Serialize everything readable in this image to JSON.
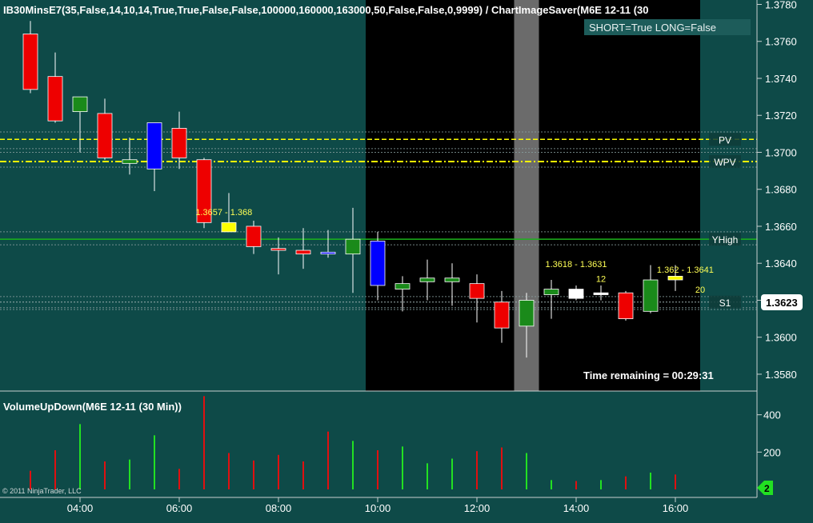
{
  "colors": {
    "background": "#0e4a48",
    "axis_background": "#0f4c4a",
    "session_shade": "#000000",
    "current_bar_shade": "#6b6b6b",
    "up_candle": "#1a8a1a",
    "down_candle": "#ee0000",
    "blue_candle": "#0000ff",
    "yellow_candle": "#ffff00",
    "white_candle": "#ffffff",
    "pv_line": "#ffff00",
    "yhigh_line": "#1bb31b",
    "volume_up": "#22e022",
    "volume_down": "#e01010",
    "text": "#ffffff",
    "label_yellow": "#ffff55"
  },
  "chart_data": [
    {
      "type": "candlestick",
      "title": "IB30MinsE7(35,False,14,10,14,True,True,False,False,100000,160000,163000,50,False,False,0,9999)  /  ChartImageSaver(M6E  12-11  (30",
      "status_box": "SHORT=True LONG=False",
      "ylim": [
        1.3575,
        1.378
      ],
      "ytick_labels": [
        "1.3780",
        "1.3760",
        "1.3740",
        "1.3720",
        "1.3700",
        "1.3680",
        "1.3660",
        "1.3640",
        "1.3620",
        "1.3600",
        "1.3580"
      ],
      "ytick_values": [
        1.378,
        1.376,
        1.374,
        1.372,
        1.37,
        1.368,
        1.366,
        1.364,
        1.362,
        1.36,
        1.358
      ],
      "xtick_labels": [
        "04:00",
        "06:00",
        "08:00",
        "10:00",
        "12:00",
        "14:00",
        "16:00"
      ],
      "xtick_hours": [
        4,
        6,
        8,
        10,
        12,
        14,
        16
      ],
      "last_price": "1.3623",
      "candles": [
        {
          "t": 3.0,
          "o": 1.3764,
          "h": 1.3771,
          "l": 1.3732,
          "c": 1.3734,
          "color": "down"
        },
        {
          "t": 3.5,
          "o": 1.3741,
          "h": 1.3754,
          "l": 1.3716,
          "c": 1.3717,
          "color": "down"
        },
        {
          "t": 4.0,
          "o": 1.3722,
          "h": 1.373,
          "l": 1.37,
          "c": 1.373,
          "color": "up"
        },
        {
          "t": 4.5,
          "o": 1.3721,
          "h": 1.3729,
          "l": 1.3696,
          "c": 1.3697,
          "color": "down"
        },
        {
          "t": 5.0,
          "o": 1.3694,
          "h": 1.3708,
          "l": 1.3688,
          "c": 1.3696,
          "color": "up"
        },
        {
          "t": 5.5,
          "o": 1.3716,
          "h": 1.3716,
          "l": 1.3679,
          "c": 1.3691,
          "color": "blue"
        },
        {
          "t": 6.0,
          "o": 1.3713,
          "h": 1.3722,
          "l": 1.3691,
          "c": 1.3697,
          "color": "down"
        },
        {
          "t": 6.5,
          "o": 1.3696,
          "h": 1.3697,
          "l": 1.3659,
          "c": 1.3662,
          "color": "down"
        },
        {
          "t": 7.0,
          "o": 1.3662,
          "h": 1.3678,
          "l": 1.3657,
          "c": 1.3657,
          "color": "yellow"
        },
        {
          "t": 7.5,
          "o": 1.366,
          "h": 1.3663,
          "l": 1.3645,
          "c": 1.3649,
          "color": "down"
        },
        {
          "t": 8.0,
          "o": 1.3648,
          "h": 1.3654,
          "l": 1.3634,
          "c": 1.3647,
          "color": "down"
        },
        {
          "t": 8.5,
          "o": 1.3647,
          "h": 1.3659,
          "l": 1.3637,
          "c": 1.3645,
          "color": "down"
        },
        {
          "t": 9.0,
          "o": 1.3645,
          "h": 1.3658,
          "l": 1.3643,
          "c": 1.3646,
          "color": "blue"
        },
        {
          "t": 9.5,
          "o": 1.3645,
          "h": 1.367,
          "l": 1.3624,
          "c": 1.3653,
          "color": "up"
        },
        {
          "t": 10.0,
          "o": 1.3652,
          "h": 1.3657,
          "l": 1.362,
          "c": 1.3628,
          "color": "blue"
        },
        {
          "t": 10.5,
          "o": 1.3626,
          "h": 1.3633,
          "l": 1.3614,
          "c": 1.3629,
          "color": "up"
        },
        {
          "t": 11.0,
          "o": 1.363,
          "h": 1.3642,
          "l": 1.362,
          "c": 1.3632,
          "color": "up"
        },
        {
          "t": 11.5,
          "o": 1.363,
          "h": 1.364,
          "l": 1.3617,
          "c": 1.3632,
          "color": "up"
        },
        {
          "t": 12.0,
          "o": 1.3629,
          "h": 1.3634,
          "l": 1.3608,
          "c": 1.3621,
          "color": "down"
        },
        {
          "t": 12.5,
          "o": 1.3619,
          "h": 1.3625,
          "l": 1.3597,
          "c": 1.3605,
          "color": "down"
        },
        {
          "t": 13.0,
          "o": 1.3606,
          "h": 1.3624,
          "l": 1.3589,
          "c": 1.362,
          "color": "up"
        },
        {
          "t": 13.5,
          "o": 1.3623,
          "h": 1.3631,
          "l": 1.361,
          "c": 1.3626,
          "color": "up"
        },
        {
          "t": 14.0,
          "o": 1.3621,
          "h": 1.3628,
          "l": 1.362,
          "c": 1.3626,
          "color": "white"
        },
        {
          "t": 14.5,
          "o": 1.3623,
          "h": 1.3628,
          "l": 1.362,
          "c": 1.3624,
          "color": "white"
        },
        {
          "t": 15.0,
          "o": 1.3624,
          "h": 1.3625,
          "l": 1.3609,
          "c": 1.361,
          "color": "down"
        },
        {
          "t": 15.5,
          "o": 1.3614,
          "h": 1.3639,
          "l": 1.3613,
          "c": 1.3631,
          "color": "up"
        },
        {
          "t": 16.0,
          "o": 1.3633,
          "h": 1.3639,
          "l": 1.3625,
          "c": 1.3631,
          "color": "yellow"
        }
      ],
      "horizontal_lines": [
        {
          "name": "PV",
          "y": 1.3707,
          "color": "#ffff00",
          "style": "dashed",
          "label": "PV"
        },
        {
          "name": "WPV",
          "y": 1.3695,
          "color": "#ffff00",
          "style": "dashdot",
          "label": "WPV"
        },
        {
          "name": "YHigh",
          "y": 1.3653,
          "color": "#1bb31b",
          "style": "solid",
          "label": "YHigh"
        },
        {
          "name": "S1",
          "y": 1.3619,
          "color": "#9aaeae",
          "style": "dotted",
          "label": "S1"
        }
      ],
      "dotted_levels": [
        1.3711,
        1.3702,
        1.37,
        1.3692,
        1.3657,
        1.365,
        1.3622,
        1.3616,
        1.3615
      ],
      "annotations": [
        {
          "text": "1.3657 - 1.368",
          "t": 6.9,
          "y": 1.3666
        },
        {
          "text": "1.3618 - 1.3631",
          "t": 14.0,
          "y": 1.3638
        },
        {
          "text": "12",
          "t": 14.5,
          "y": 1.363
        },
        {
          "text": "1.362 - 1.3641",
          "t": 16.2,
          "y": 1.3635
        },
        {
          "text": "20",
          "t": 16.5,
          "y": 1.3624
        }
      ],
      "session_shade_hours": [
        10.0,
        16.5
      ],
      "current_bar_hours": [
        12.75,
        13.25
      ],
      "time_remaining": "Time remaining = 00:29:31"
    },
    {
      "type": "bar",
      "title": "VolumeUpDown(M6E 12-11 (30 Min))",
      "ylim": [
        0,
        480
      ],
      "ytick_labels": [
        "400",
        "200"
      ],
      "ytick_values": [
        400,
        200
      ],
      "right_marker": "2",
      "series": [
        {
          "name": "up",
          "points": [
            [
              4.0,
              350
            ],
            [
              5.0,
              160
            ],
            [
              5.5,
              290
            ],
            [
              9.5,
              260
            ],
            [
              10.5,
              230
            ],
            [
              11.0,
              140
            ],
            [
              11.5,
              165
            ],
            [
              13.0,
              195
            ],
            [
              13.5,
              50
            ],
            [
              14.5,
              50
            ],
            [
              15.5,
              90
            ]
          ]
        },
        {
          "name": "down",
          "points": [
            [
              3.0,
              100
            ],
            [
              3.5,
              210
            ],
            [
              4.5,
              150
            ],
            [
              6.0,
              110
            ],
            [
              6.5,
              500
            ],
            [
              7.0,
              195
            ],
            [
              7.5,
              155
            ],
            [
              8.0,
              185
            ],
            [
              8.5,
              150
            ],
            [
              9.0,
              310
            ],
            [
              10.0,
              210
            ],
            [
              12.0,
              205
            ],
            [
              12.5,
              225
            ],
            [
              14.0,
              45
            ],
            [
              15.0,
              70
            ],
            [
              16.0,
              80
            ]
          ]
        }
      ]
    }
  ],
  "copyright": "© 2011 NinjaTrader, LLC"
}
